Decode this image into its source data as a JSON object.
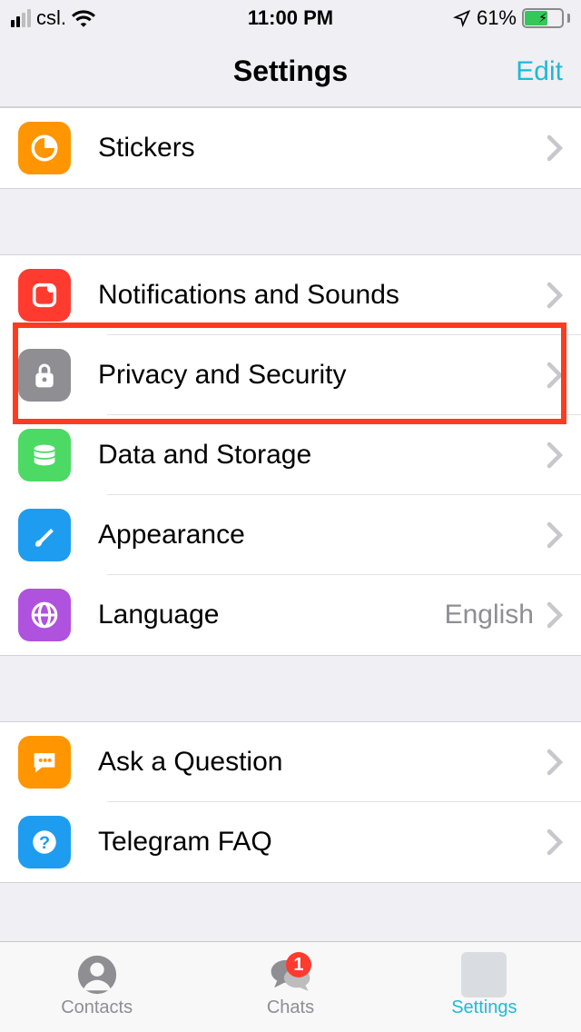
{
  "status": {
    "carrier": "csl.",
    "time": "11:00 PM",
    "battery_pct": "61%"
  },
  "header": {
    "title": "Settings",
    "edit": "Edit"
  },
  "groups": [
    {
      "rows": [
        {
          "id": "stickers",
          "icon": "stickers-icon",
          "color": "ic-orange",
          "label": "Stickers"
        }
      ]
    },
    {
      "rows": [
        {
          "id": "notifications",
          "icon": "bell-icon",
          "color": "ic-red",
          "label": "Notifications and Sounds"
        },
        {
          "id": "privacy",
          "icon": "lock-icon",
          "color": "ic-gray",
          "label": "Privacy and Security",
          "highlighted": true
        },
        {
          "id": "data",
          "icon": "disk-icon",
          "color": "ic-green",
          "label": "Data and Storage"
        },
        {
          "id": "appearance",
          "icon": "brush-icon",
          "color": "ic-blue",
          "label": "Appearance"
        },
        {
          "id": "language",
          "icon": "globe-icon",
          "color": "ic-purple",
          "label": "Language",
          "value": "English"
        }
      ]
    },
    {
      "rows": [
        {
          "id": "ask",
          "icon": "chat-icon",
          "color": "ic-amber",
          "label": "Ask a Question"
        },
        {
          "id": "faq",
          "icon": "question-icon",
          "color": "ic-cyan",
          "label": "Telegram FAQ"
        }
      ]
    }
  ],
  "tabs": {
    "contacts": "Contacts",
    "chats": "Chats",
    "chats_badge": "1",
    "settings": "Settings"
  }
}
